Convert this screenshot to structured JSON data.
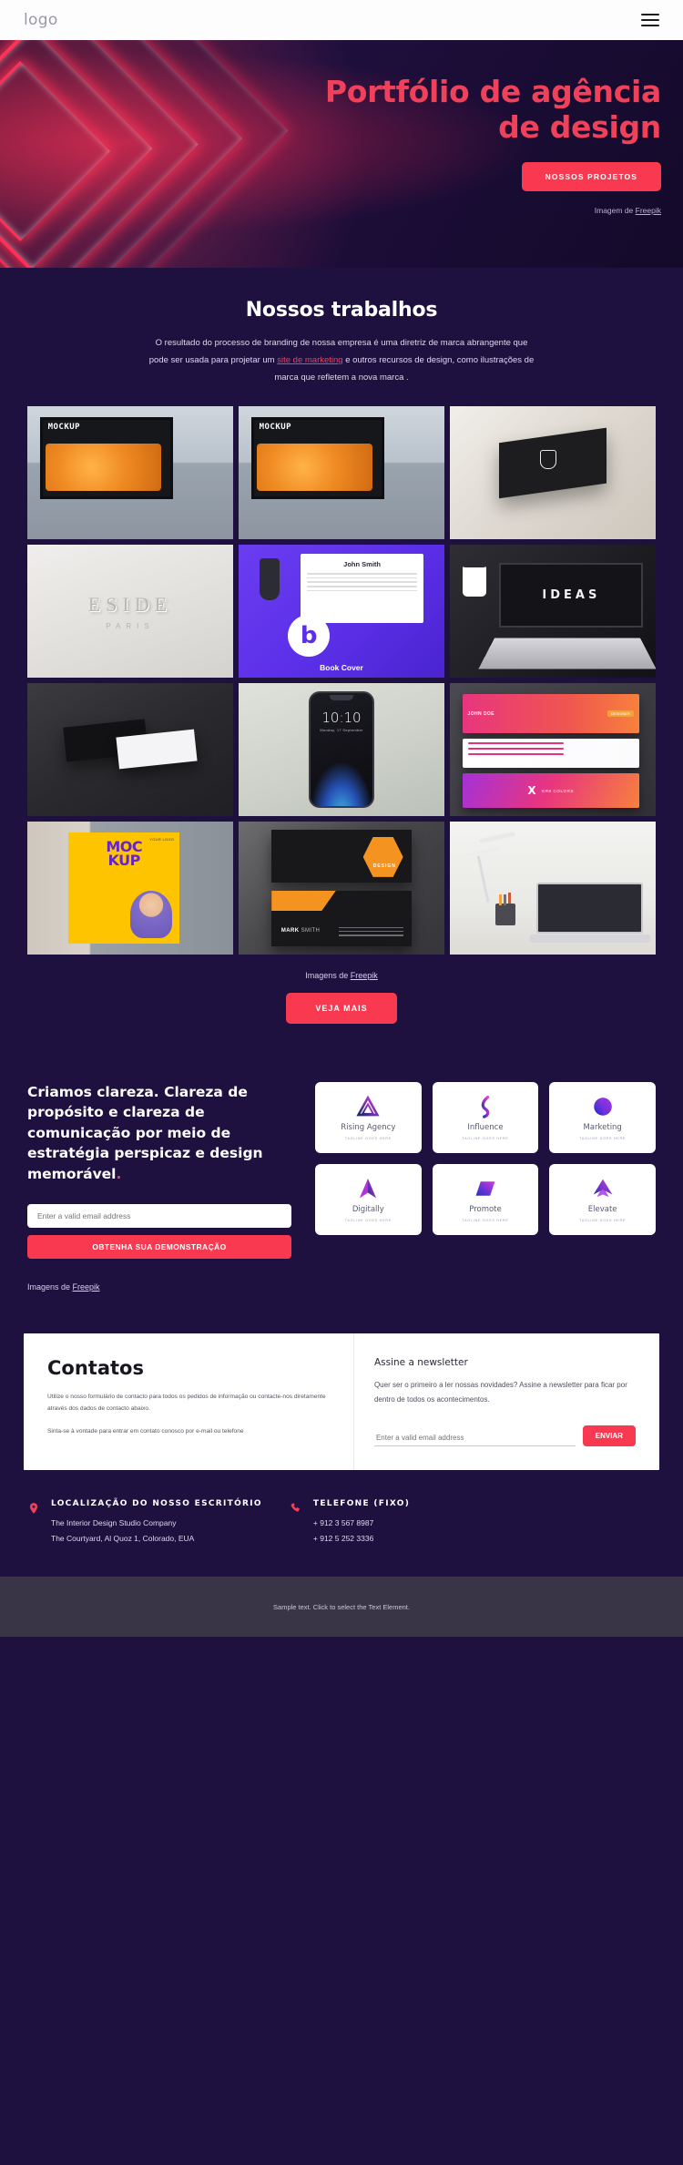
{
  "header": {
    "logo": "logo",
    "menu_icon": "hamburger-icon"
  },
  "hero": {
    "title_line1": "Portfólio de agência",
    "title_line2": "de design",
    "cta": "NOSSOS PROJETOS",
    "credit_prefix": "Imagem de ",
    "credit_link": "Freepik",
    "accent": "#f0415a",
    "button_color": "#f9394f"
  },
  "works": {
    "title": "Nossos trabalhos",
    "sub_part1": "O resultado do processo de branding de nossa empresa é uma diretriz de marca abrangente que pode ser usada para projetar um ",
    "sub_link": "site de marketing",
    "sub_part2": " e outros recursos de design, como ilustrações de marca que refletem a nova marca .",
    "credit_prefix": "Imagens de ",
    "credit_link": "Freepik",
    "more_button": "VEJA MAIS",
    "tiles": [
      {
        "name": "billboard-mockup-1",
        "word": "MOCKUP"
      },
      {
        "name": "billboard-mockup-2",
        "word": "MOCKUP"
      },
      {
        "name": "black-box-logo-mockup",
        "word": ""
      },
      {
        "name": "eside-paris-sign",
        "main": "ESIDE",
        "sub": "PARIS"
      },
      {
        "name": "book-cover-mockup",
        "person": "John Smith",
        "letter": "b",
        "caption": "Book Cover"
      },
      {
        "name": "ideas-laptop",
        "word": "IDEAS"
      },
      {
        "name": "business-cards-dark",
        "word": ""
      },
      {
        "name": "phone-mockup",
        "time": "10:10",
        "date": "Monday, 17 September"
      },
      {
        "name": "pink-gradient-cards",
        "nm": "JOHN DOE",
        "tag": "DESIGNER",
        "foot": "GR8 COLORS",
        "x": "X"
      },
      {
        "name": "mockup-poster-building",
        "t1": "MOC",
        "t2": "KUP",
        "logo": "YOUR LOGO"
      },
      {
        "name": "orange-design-cards",
        "brand": "DESIGN",
        "nm_bold": "MARK",
        "nm_light": "SMITH"
      },
      {
        "name": "desk-lamp-laptop",
        "word": ""
      }
    ]
  },
  "clarity": {
    "heading_main": "Criamos clareza. Clareza de propósito e clareza de comunicação por meio de estratégia perspicaz e design memorável",
    "heading_dot": ".",
    "email_placeholder": "Enter a valid email address",
    "demo_button": "OBTENHA SUA DEMONSTRAÇÃO",
    "credit_prefix": "Imagens de ",
    "credit_link": "Freepik",
    "logos": [
      {
        "name": "Rising",
        "name2": " Agency",
        "tag": "TAGLINE GOES HERE"
      },
      {
        "name": "Influence",
        "name2": "",
        "tag": "TAGLINE GOES HERE"
      },
      {
        "name": "Marketing",
        "name2": "",
        "tag": "TAGLINE GOES HERE"
      },
      {
        "name": "Digitally",
        "name2": "",
        "tag": "TAGLINE GOES HERE"
      },
      {
        "name": "Promote",
        "name2": "",
        "tag": "TAGLINE GOES HERE"
      },
      {
        "name": "Elevate",
        "name2": "",
        "tag": "TAGLINE GOES HERE"
      }
    ]
  },
  "contact": {
    "title": "Contatos",
    "p1": "Utilize o nosso formulário de contacto para todos os pedidos de informação ou contacte-nos diretamente através dos dados de contacto abaixo.",
    "p2": "Sinta-se à vontade para entrar em contato conosco por e-mail ou telefone",
    "newsletter_title": "Assine a newsletter",
    "newsletter_sub": "Quer ser o primeiro a ler nossas novidades? Assine a newsletter para ficar por dentro de todos os acontecimentos.",
    "newsletter_placeholder": "Enter a valid email address",
    "newsletter_button": "ENVIAR"
  },
  "footer_info": {
    "office": {
      "icon": "map-pin-icon",
      "heading": "LOCALIZAÇÃO DO NOSSO ESCRITÓRIO",
      "line1": "The Interior Design Studio Company",
      "line2": "The Courtyard, Al Quoz 1, Colorado,  EUA"
    },
    "phone": {
      "icon": "phone-icon",
      "heading": "TELEFONE (FIXO)",
      "line1": "+ 912 3 567 8987",
      "line2": "+ 912 5 252 3336"
    }
  },
  "bottombar": {
    "text": "Sample text. Click to select the Text Element."
  }
}
